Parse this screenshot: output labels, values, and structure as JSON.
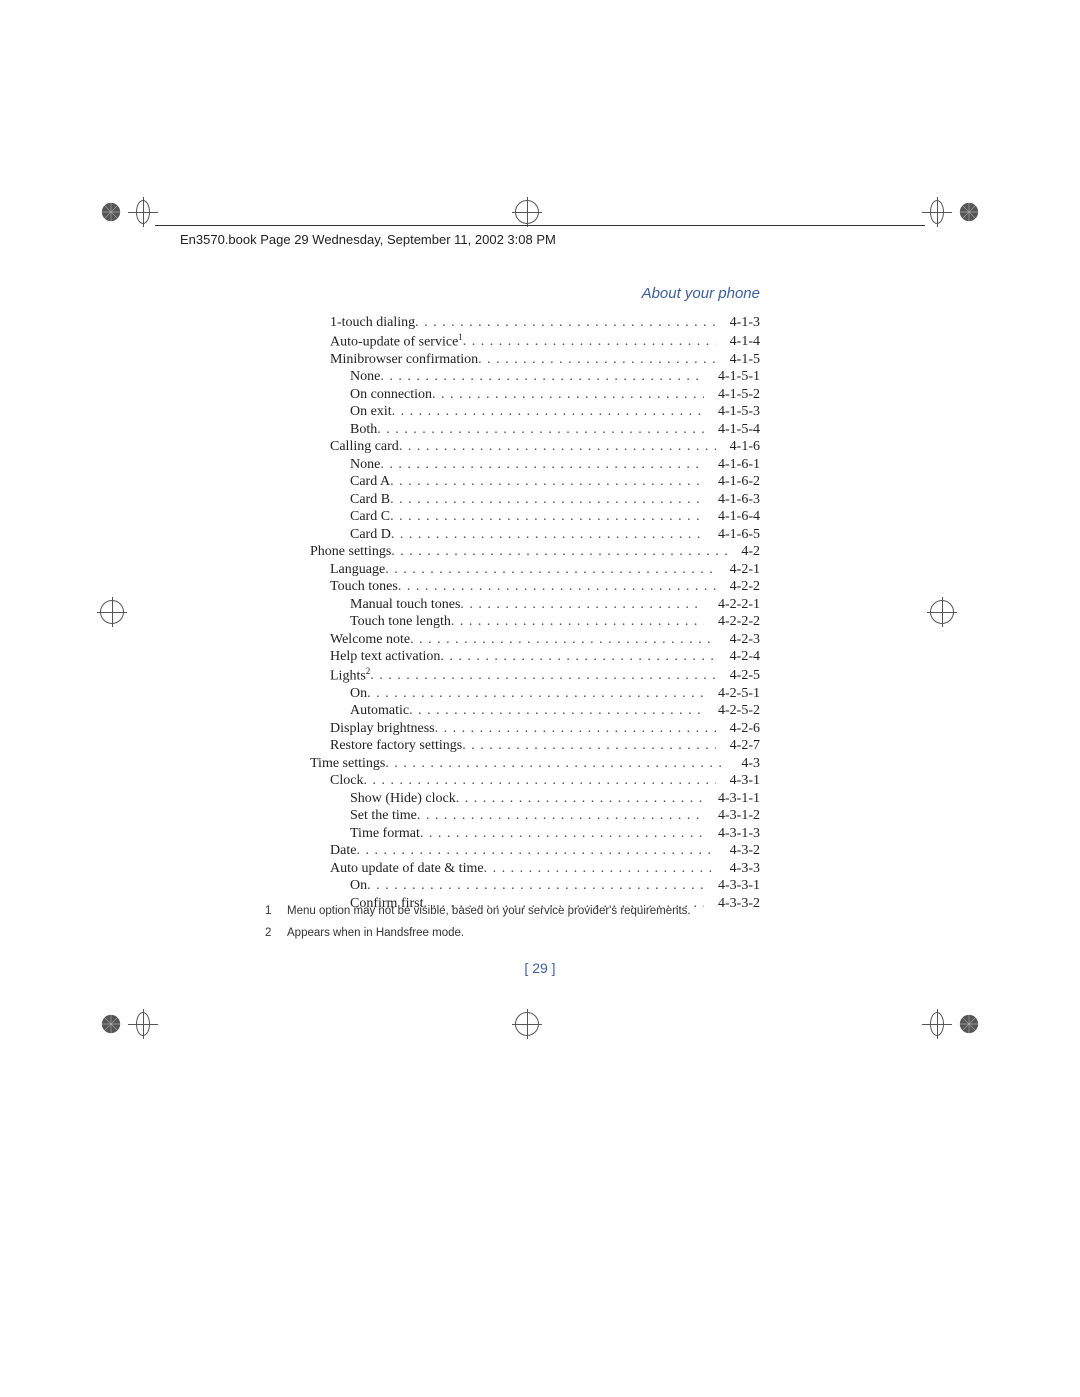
{
  "header": "En3570.book  Page 29  Wednesday, September 11, 2002  3:08 PM",
  "section_title": "About your phone",
  "toc": [
    {
      "label": "1-touch dialing",
      "num": "4-1-3",
      "indent": 1
    },
    {
      "label": "Auto-update of service",
      "sup": "1",
      "num": "4-1-4",
      "indent": 1
    },
    {
      "label": "Minibrowser confirmation",
      "num": "4-1-5",
      "indent": 1
    },
    {
      "label": "None",
      "num": "4-1-5-1",
      "indent": 2
    },
    {
      "label": "On connection",
      "num": "4-1-5-2",
      "indent": 2
    },
    {
      "label": "On exit",
      "num": "4-1-5-3",
      "indent": 2
    },
    {
      "label": "Both",
      "num": "4-1-5-4",
      "indent": 2
    },
    {
      "label": "Calling card",
      "num": "4-1-6",
      "indent": 1
    },
    {
      "label": "None",
      "num": "4-1-6-1",
      "indent": 2
    },
    {
      "label": "Card A",
      "num": "4-1-6-2",
      "indent": 2
    },
    {
      "label": "Card B",
      "num": "4-1-6-3",
      "indent": 2
    },
    {
      "label": "Card C",
      "num": "4-1-6-4",
      "indent": 2
    },
    {
      "label": "Card D",
      "num": "4-1-6-5",
      "indent": 2
    },
    {
      "label": "Phone settings",
      "num": "4-2",
      "indent": 0
    },
    {
      "label": "Language",
      "num": "4-2-1",
      "indent": 1
    },
    {
      "label": "Touch tones",
      "num": "4-2-2",
      "indent": 1
    },
    {
      "label": "Manual touch tones",
      "num": "4-2-2-1",
      "indent": 2
    },
    {
      "label": "Touch tone length",
      "num": "4-2-2-2",
      "indent": 2
    },
    {
      "label": "Welcome note",
      "num": "4-2-3",
      "indent": 1
    },
    {
      "label": "Help text activation",
      "num": "4-2-4",
      "indent": 1
    },
    {
      "label": "Lights",
      "sup": "2",
      "num": "4-2-5",
      "indent": 1
    },
    {
      "label": "On",
      "num": "4-2-5-1",
      "indent": 2
    },
    {
      "label": "Automatic",
      "num": "4-2-5-2",
      "indent": 2
    },
    {
      "label": "Display brightness",
      "num": "4-2-6",
      "indent": 1
    },
    {
      "label": "Restore factory settings",
      "num": "4-2-7",
      "indent": 1
    },
    {
      "label": "Time settings",
      "num": "4-3",
      "indent": 0
    },
    {
      "label": "Clock",
      "num": "4-3-1",
      "indent": 1
    },
    {
      "label": "Show (Hide) clock",
      "num": "4-3-1-1",
      "indent": 2
    },
    {
      "label": "Set the time",
      "num": "4-3-1-2",
      "indent": 2
    },
    {
      "label": "Time format",
      "num": "4-3-1-3",
      "indent": 2
    },
    {
      "label": "Date",
      "num": "4-3-2",
      "indent": 1
    },
    {
      "label": "Auto update of date & time",
      "num": "4-3-3",
      "indent": 1
    },
    {
      "label": "On",
      "num": "4-3-3-1",
      "indent": 2
    },
    {
      "label": "Confirm first",
      "num": "4-3-3-2",
      "indent": 2
    }
  ],
  "footnotes": [
    {
      "num": "1",
      "text": "Menu option may not be visible, based on your service provider's requirements."
    },
    {
      "num": "2",
      "text": "Appears when in Handsfree mode."
    }
  ],
  "page_number": "[ 29 ]"
}
